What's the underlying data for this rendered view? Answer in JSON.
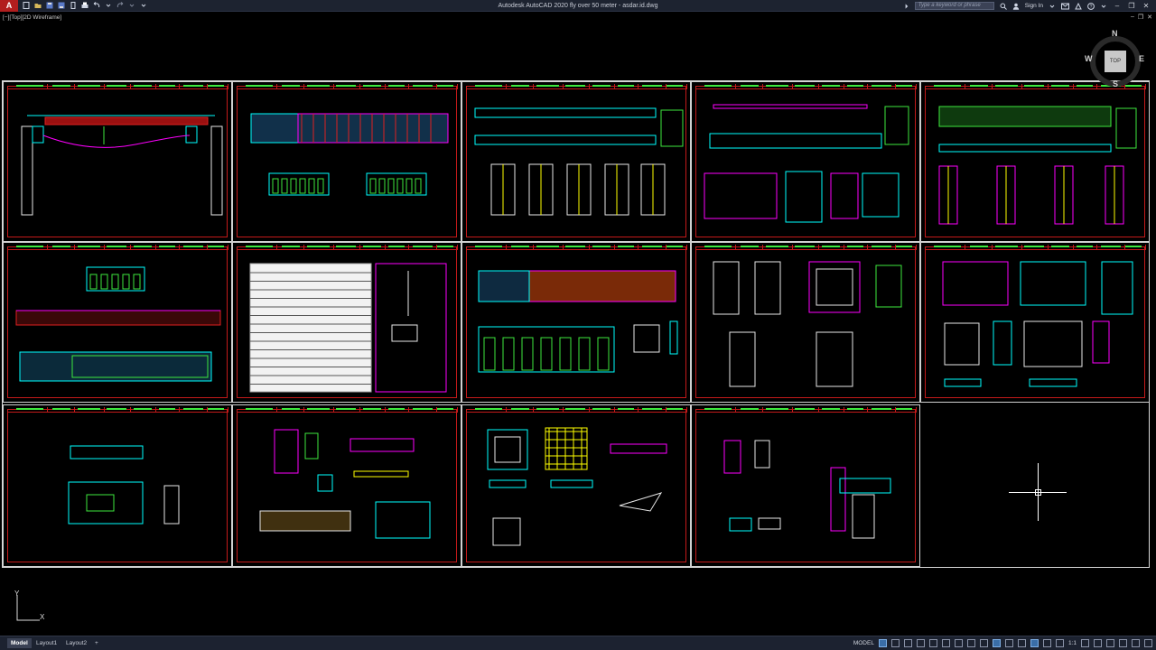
{
  "app": {
    "title": "Autodesk AutoCAD 2020   fly over 50 meter - asdar.id.dwg",
    "menu_letter": "A",
    "search_placeholder": "Type a keyword or phrase",
    "sign_in": "Sign In",
    "help": "?"
  },
  "viewport": {
    "label": "[−][Top][2D Wireframe]"
  },
  "viewcube": {
    "top": "TOP",
    "n": "N",
    "s": "S",
    "e": "E",
    "w": "W"
  },
  "ucs": {
    "x": "X",
    "y": "Y"
  },
  "tabs": [
    {
      "label": "Model"
    },
    {
      "label": "Layout1"
    },
    {
      "label": "Layout2"
    },
    {
      "label": "+"
    }
  ],
  "status": {
    "model": "MODEL",
    "scale": "1:1"
  },
  "colors": {
    "frame_red": "#c41a1a",
    "green": "#3ee83e",
    "cyan": "#00ffff",
    "magenta": "#ff00ff",
    "yellow": "#ffff00"
  }
}
